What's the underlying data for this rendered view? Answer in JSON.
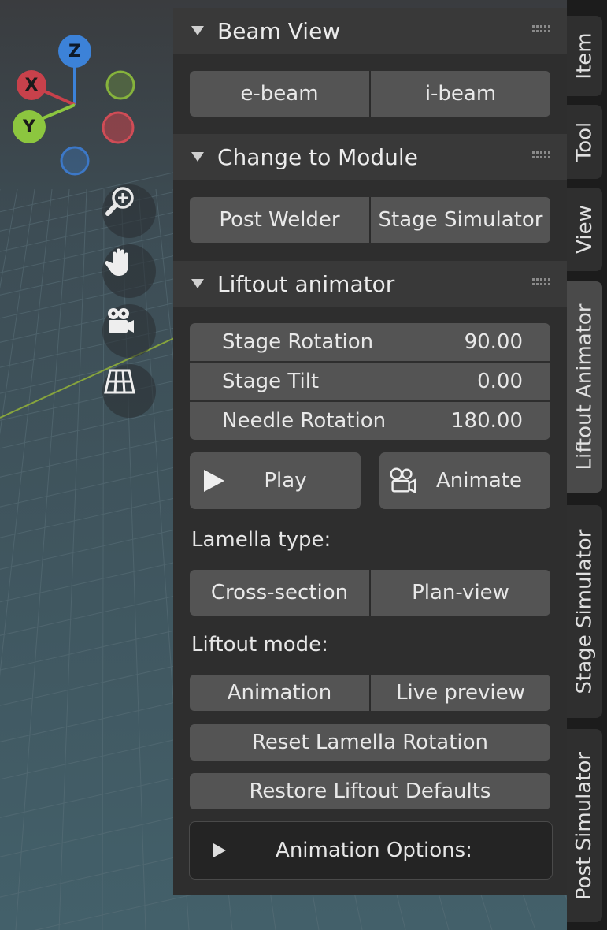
{
  "viewport": {
    "gizmo": {
      "z_label": "Z",
      "x_label": "X",
      "y_label": "Y"
    },
    "nav_icons": [
      "zoom-icon",
      "hand-icon",
      "camera-icon",
      "grid-icon"
    ]
  },
  "panels": {
    "beam_view": {
      "title": "Beam View",
      "buttons": [
        "e-beam",
        "i-beam"
      ]
    },
    "change_module": {
      "title": "Change to Module",
      "buttons": [
        "Post Welder",
        "Stage Simulator"
      ]
    },
    "liftout": {
      "title": "Liftout animator",
      "fields": [
        {
          "label": "Stage Rotation",
          "value": "90.00"
        },
        {
          "label": "Stage Tilt",
          "value": "0.00"
        },
        {
          "label": "Needle Rotation",
          "value": "180.00"
        }
      ],
      "play_label": "Play",
      "animate_label": "Animate",
      "lamella_type_label": "Lamella type:",
      "lamella_options": [
        "Cross-section",
        "Plan-view"
      ],
      "liftout_mode_label": "Liftout mode:",
      "mode_options": [
        "Animation",
        "Live preview"
      ],
      "reset_label": "Reset Lamella Rotation",
      "restore_label": "Restore Liftout Defaults",
      "anim_options_label": "Animation Options:"
    }
  },
  "tabs": [
    "Item",
    "Tool",
    "View",
    "Liftout Animator",
    "Stage Simulator",
    "Post Simulator"
  ],
  "active_tab": "Liftout Animator",
  "colors": {
    "x_axis": "#c8414b",
    "y_axis": "#8cc63f",
    "z_axis": "#3c82d8",
    "panel_bg": "#2e2e2e",
    "button_bg": "#545454"
  }
}
